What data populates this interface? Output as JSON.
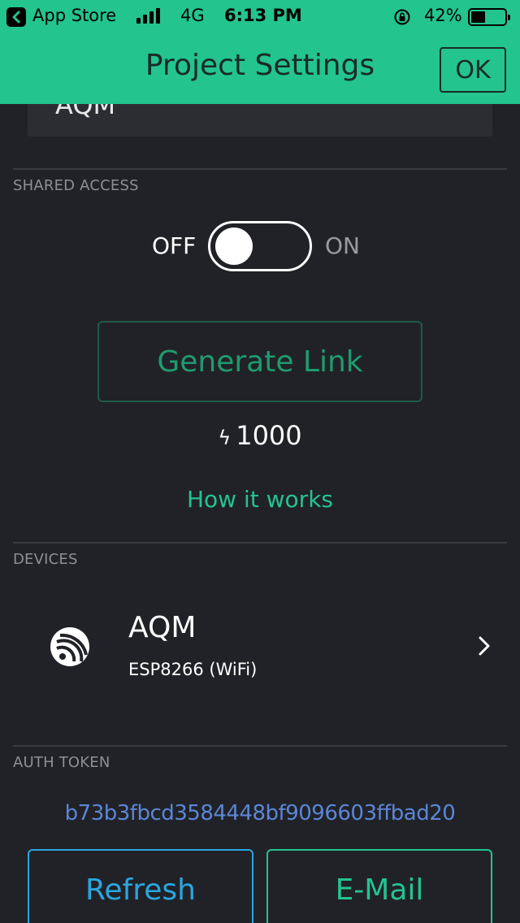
{
  "status_bar": {
    "back_app": "App Store",
    "network": "4G",
    "time": "6:13 PM",
    "battery_percent": "42%",
    "battery_level": 0.42,
    "signal_bars": 4
  },
  "header": {
    "title": "Project Settings",
    "ok_label": "OK",
    "background_color": "#23c48e"
  },
  "project": {
    "name": "AQM"
  },
  "shared_access": {
    "section_label": "SHARED ACCESS",
    "toggle_off_label": "OFF",
    "toggle_on_label": "ON",
    "enabled": false,
    "generate_label": "Generate Link",
    "energy_cost": "1000",
    "how_it_works": "How it works"
  },
  "devices": {
    "section_label": "DEVICES",
    "items": [
      {
        "name": "AQM",
        "type": "ESP8266 (WiFi)",
        "icon": "espressif-icon"
      }
    ]
  },
  "auth": {
    "section_label": "AUTH TOKEN",
    "token": "b73b3fbcd3584448bf9096603ffbad20",
    "refresh_label": "Refresh",
    "email_label": "E-Mail"
  },
  "colors": {
    "accent": "#23c48e",
    "background": "#212227",
    "token_link": "#5b86d6",
    "refresh": "#2aa6e0"
  }
}
